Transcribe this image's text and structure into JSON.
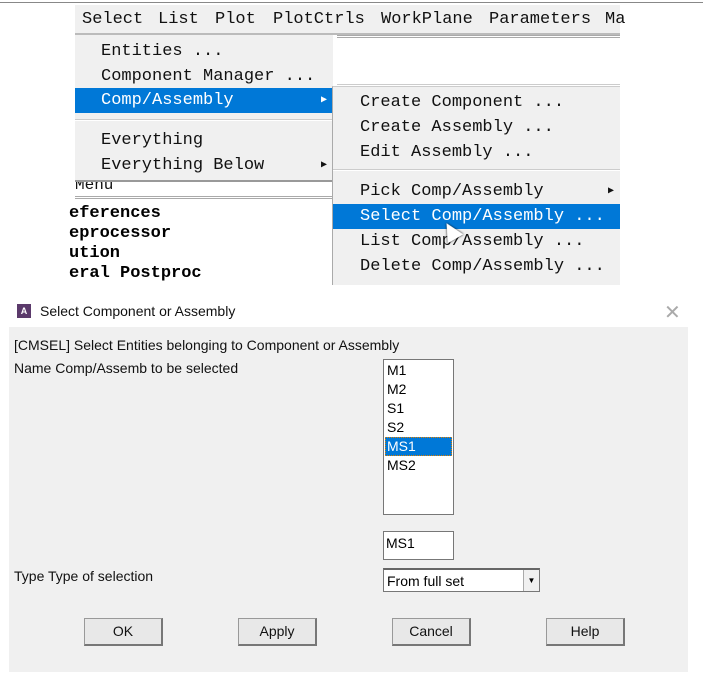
{
  "menubar": {
    "items": [
      "Select",
      "List",
      "Plot",
      "PlotCtrls",
      "WorkPlane",
      "Parameters",
      "Ma"
    ]
  },
  "select_menu": {
    "items": [
      "Entities ...",
      "Component Manager ...",
      "Comp/Assembly",
      "Everything",
      "Everything Below"
    ],
    "highlighted": "Comp/Assembly"
  },
  "submenu": {
    "items": [
      "Create Component ...",
      "Create Assembly ...",
      "Edit Assembly ...",
      "Pick Comp/Assembly",
      "Select Comp/Assembly ...",
      "List Comp/Assembly ...",
      "Delete Comp/Assembly ..."
    ],
    "highlighted": "Select Comp/Assembly ..."
  },
  "background": {
    "menu_label": "Menu",
    "tree": [
      "eferences",
      "eprocessor",
      "ution",
      "eral Postproc"
    ]
  },
  "dialog": {
    "title": "Select Component or Assembly",
    "icon_letter": "A",
    "command_desc": "[CMSEL]  Select Entities belonging to Component or Assembly",
    "name_label": "Name  Comp/Assemb to be selected",
    "list_items": [
      "M1",
      "M2",
      "S1",
      "S2",
      "MS1",
      "MS2"
    ],
    "selected_item": "MS1",
    "name_value": "MS1",
    "type_label": "Type  Type of selection",
    "type_value": "From full set",
    "buttons": [
      "OK",
      "Apply",
      "Cancel",
      "Help"
    ]
  },
  "colors": {
    "highlight": "#0078d7",
    "dialog_bg": "#f0f0f0"
  }
}
